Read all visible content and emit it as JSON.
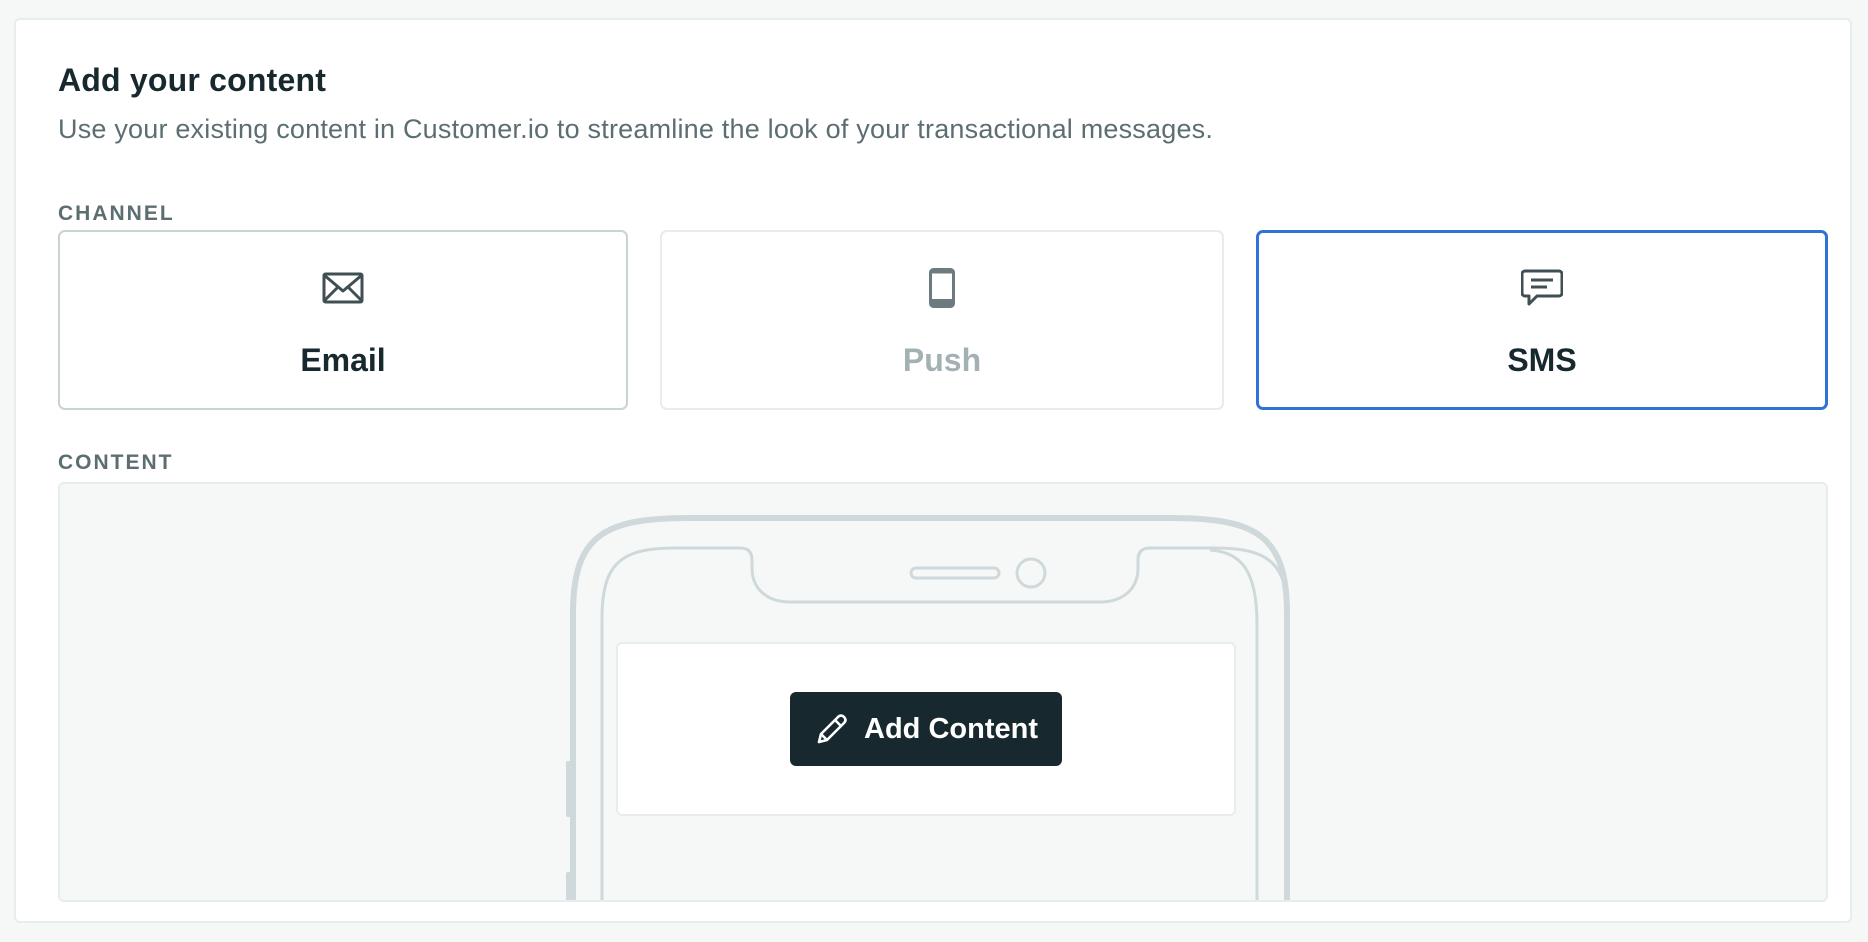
{
  "header": {
    "title": "Add your content",
    "subtitle": "Use your existing content in Customer.io to streamline the look of your transactional messages."
  },
  "channel": {
    "label": "CHANNEL",
    "selected": "SMS",
    "options": [
      {
        "label": "Email",
        "icon": "envelope-icon",
        "state": "enabled"
      },
      {
        "label": "Push",
        "icon": "mobile-phone-icon",
        "state": "disabled"
      },
      {
        "label": "SMS",
        "icon": "chat-bubble-icon",
        "state": "selected"
      }
    ]
  },
  "content": {
    "label": "CONTENT",
    "button_label": "Add Content",
    "button_icon": "pencil-icon"
  },
  "colors": {
    "selected_border": "#2f72d8",
    "button_bg": "#17292e",
    "text_primary": "#17292e",
    "text_muted": "#5d6e72",
    "text_disabled": "#a3b1b4"
  }
}
